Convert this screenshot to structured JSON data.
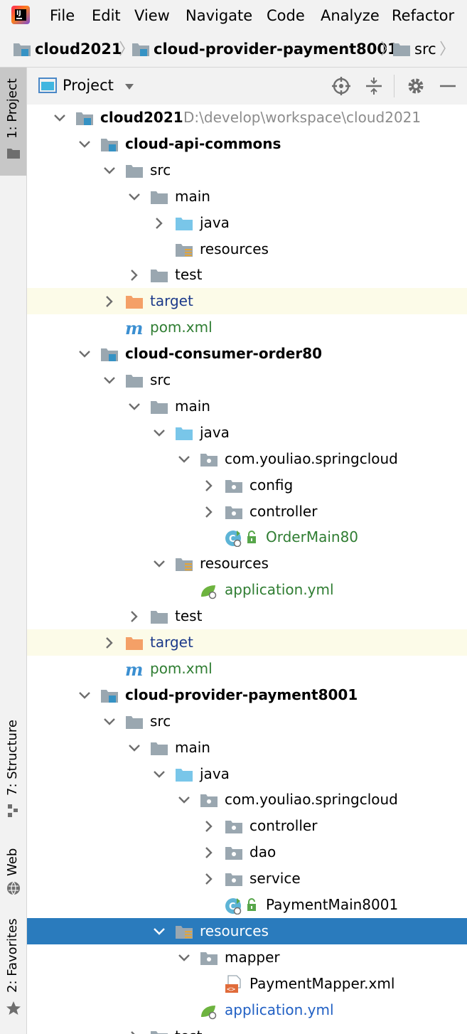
{
  "menu": {
    "items": [
      {
        "key": "file",
        "label": "File"
      },
      {
        "key": "edit",
        "label": "Edit"
      },
      {
        "key": "view",
        "label": "View"
      },
      {
        "key": "navigate",
        "label": "Navigate"
      },
      {
        "key": "code",
        "label": "Code"
      },
      {
        "key": "analyze",
        "label": "Analyze"
      },
      {
        "key": "refactor",
        "label": "Refactor"
      }
    ]
  },
  "breadcrumb": {
    "items": [
      "cloud2021",
      "cloud-provider-payment8001",
      "src"
    ]
  },
  "left_tabs": {
    "project": "1: Project",
    "structure": "7: Structure",
    "web": "Web",
    "favorites": "2: Favorites"
  },
  "project_panel": {
    "title": "Project"
  },
  "tree": [
    {
      "label": "cloud2021",
      "path": "D:\\develop\\workspace\\cloud2021",
      "icon": "module-folder-icon"
    },
    {
      "label": "cloud-api-commons",
      "icon": "module-folder-icon"
    },
    {
      "label": "src",
      "icon": "folder-icon"
    },
    {
      "label": "main",
      "icon": "folder-icon"
    },
    {
      "label": "java",
      "icon": "source-folder-icon"
    },
    {
      "label": "resources",
      "icon": "resources-folder-icon"
    },
    {
      "label": "test",
      "icon": "folder-icon"
    },
    {
      "label": "target",
      "icon": "excluded-folder-icon"
    },
    {
      "label": "pom.xml",
      "icon": "maven-icon"
    },
    {
      "label": "cloud-consumer-order80",
      "icon": "module-folder-icon"
    },
    {
      "label": "src",
      "icon": "folder-icon"
    },
    {
      "label": "main",
      "icon": "folder-icon"
    },
    {
      "label": "java",
      "icon": "source-folder-icon"
    },
    {
      "label": "com.youliao.springcloud",
      "icon": "package-icon"
    },
    {
      "label": "config",
      "icon": "package-icon"
    },
    {
      "label": "controller",
      "icon": "package-icon"
    },
    {
      "label": "OrderMain80",
      "icon": "spring-boot-class-icon"
    },
    {
      "label": "resources",
      "icon": "resources-folder-icon"
    },
    {
      "label": "application.yml",
      "icon": "spring-yaml-icon"
    },
    {
      "label": "test",
      "icon": "folder-icon"
    },
    {
      "label": "target",
      "icon": "excluded-folder-icon"
    },
    {
      "label": "pom.xml",
      "icon": "maven-icon"
    },
    {
      "label": "cloud-provider-payment8001",
      "icon": "module-folder-icon"
    },
    {
      "label": "src",
      "icon": "folder-icon"
    },
    {
      "label": "main",
      "icon": "folder-icon"
    },
    {
      "label": "java",
      "icon": "source-folder-icon"
    },
    {
      "label": "com.youliao.springcloud",
      "icon": "package-icon"
    },
    {
      "label": "controller",
      "icon": "package-icon"
    },
    {
      "label": "dao",
      "icon": "package-icon"
    },
    {
      "label": "service",
      "icon": "package-icon"
    },
    {
      "label": "PaymentMain8001",
      "icon": "spring-boot-class-icon"
    },
    {
      "label": "resources",
      "icon": "resources-folder-icon"
    },
    {
      "label": "mapper",
      "icon": "package-icon"
    },
    {
      "label": "PaymentMapper.xml",
      "icon": "xml-file-icon"
    },
    {
      "label": "application.yml",
      "icon": "spring-yaml-icon"
    },
    {
      "label": "test",
      "icon": "folder-icon"
    }
  ],
  "colors": {
    "selection": "#2a7bbd",
    "excluded_highlight": "#fcfbe8",
    "maven_blue": "#1c3a8a",
    "vcs_green": "#2f7d32"
  }
}
